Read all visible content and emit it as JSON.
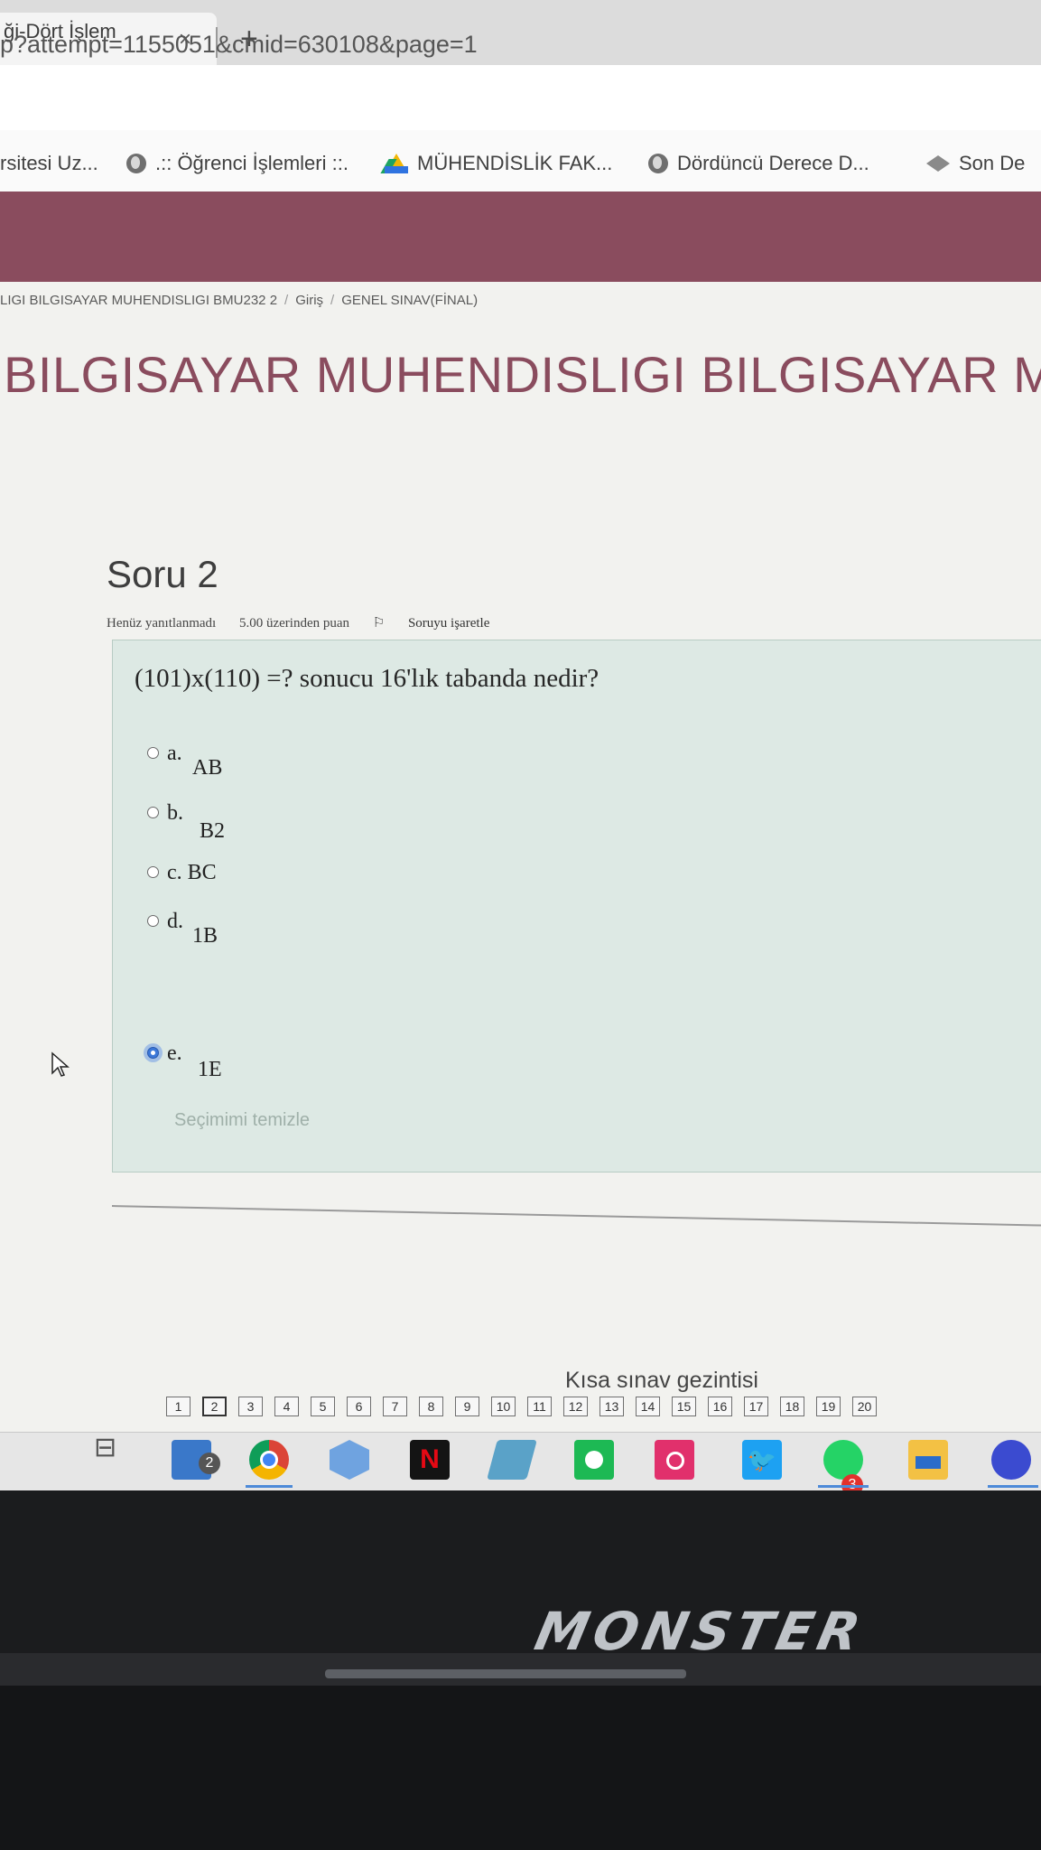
{
  "browser": {
    "tab_title": "ği-Dört İşlem",
    "tab_close": "×",
    "new_tab": "+",
    "url": "p?attempt=1155051&cmid=630108&page=1",
    "bookmarks": [
      {
        "label": "rsitesi Uz...",
        "icon": "none"
      },
      {
        "label": ".:: Öğrenci İşlemleri ::.",
        "icon": "globe-icon"
      },
      {
        "label": "MÜHENDİSLİK FAK...",
        "icon": "google-drive-icon"
      },
      {
        "label": "Dördüncü Derece D...",
        "icon": "globe-icon"
      },
      {
        "label": "Son De",
        "icon": "bookmark-icon"
      }
    ]
  },
  "page": {
    "breadcrumb": [
      "LIGI BILGISAYAR MUHENDISLIGI BMU232 2",
      "Giriş",
      "GENEL SINAV(FİNAL)"
    ],
    "breadcrumb_separator": "/",
    "course_title": "BILGISAYAR MUHENDISLIGI BILGISAYAR MU",
    "header_color": "#8a4c5e"
  },
  "question": {
    "number_label": "Soru 2",
    "status": "Henüz yanıtlanmadı",
    "points": "5.00 üzerinden puan",
    "flag_icon": "⚐",
    "flag_label": "Soruyu işaretle",
    "text": "(101)x(110) =? sonucu 16'lık tabanda nedir?",
    "answers": [
      {
        "letter": "a.",
        "text": "AB",
        "checked": false
      },
      {
        "letter": "b.",
        "text": "B2",
        "checked": false
      },
      {
        "letter": "c. BC",
        "text": "",
        "checked": false
      },
      {
        "letter": "d.",
        "text": "1B",
        "checked": false
      },
      {
        "letter": "e.",
        "text": "1E",
        "checked": true
      }
    ],
    "clear_choice": "Seçimimi temizle"
  },
  "quiz_navigation": {
    "title": "Kısa sınav gezintisi",
    "buttons": [
      "1",
      "2",
      "3",
      "4",
      "5",
      "6",
      "7",
      "8",
      "9",
      "10",
      "11",
      "12",
      "13",
      "14",
      "15",
      "16",
      "17",
      "18",
      "19",
      "20"
    ],
    "current": "2"
  },
  "taskbar": {
    "task_view_glyph": "⊟",
    "mail_badge": "2",
    "netflix_glyph": "N",
    "twitter_glyph": "🐦",
    "whatsapp_badge": "3",
    "apps": [
      "task-view-icon",
      "mail-icon",
      "chrome-icon",
      "3d-viewer-icon",
      "netflix-icon",
      "photos-icon",
      "spotify-icon",
      "instagram-icon",
      "twitter-icon",
      "whatsapp-icon",
      "file-explorer-icon",
      "game-icon"
    ]
  },
  "laptop": {
    "brand": "MONSTER"
  }
}
